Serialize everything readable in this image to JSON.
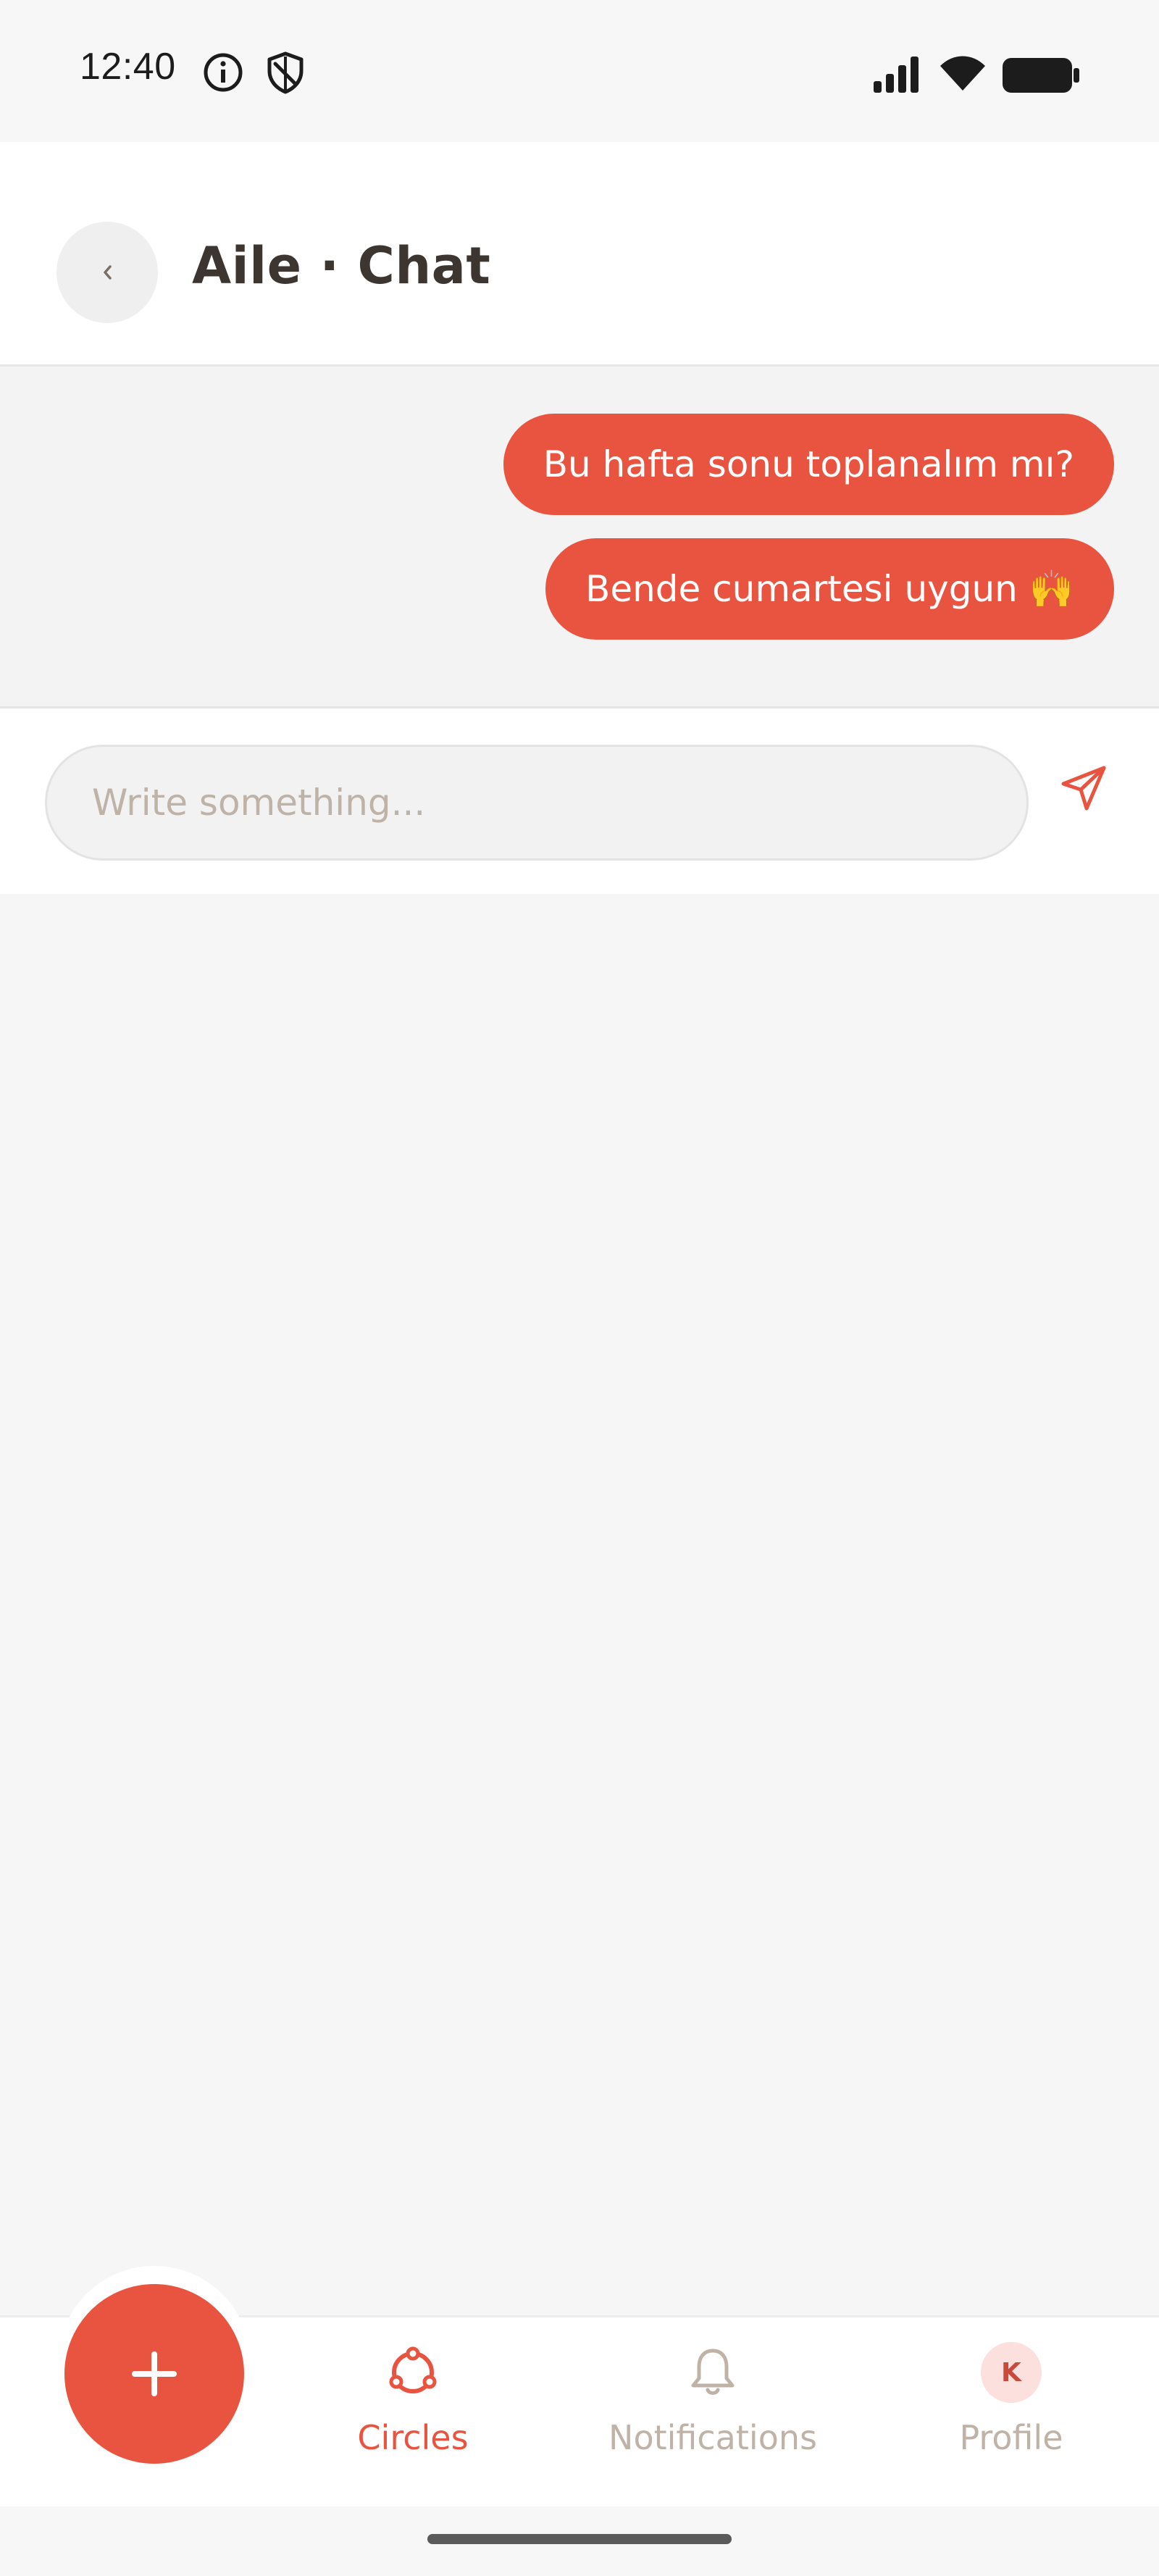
{
  "status_bar": {
    "time": "12:40",
    "left_icons": [
      "info-icon",
      "shield-icon"
    ],
    "right_icons": [
      "signal-icon",
      "wifi-icon",
      "battery-icon"
    ]
  },
  "header": {
    "back_glyph": "‹",
    "title": "Aile · Chat"
  },
  "messages": [
    {
      "text": "Bu hafta sonu toplanalım mı?",
      "sender": "me"
    },
    {
      "text": "Bende cumartesi uygun 🙌",
      "sender": "me"
    }
  ],
  "composer": {
    "placeholder": "Write something...",
    "value": ""
  },
  "fab": {
    "glyph": "+"
  },
  "bottom_nav": {
    "items": [
      {
        "label": "Circles",
        "icon": "circles-icon",
        "active": true
      },
      {
        "label": "Notifications",
        "icon": "bell-icon",
        "active": false
      },
      {
        "label": "Profile",
        "icon": "avatar",
        "active": false,
        "avatar_initial": "K"
      }
    ]
  },
  "colors": {
    "accent": "#e95441",
    "inactive": "#bfb2a6",
    "text": "#3d3530",
    "avatar_bg": "#fbe0dd"
  }
}
